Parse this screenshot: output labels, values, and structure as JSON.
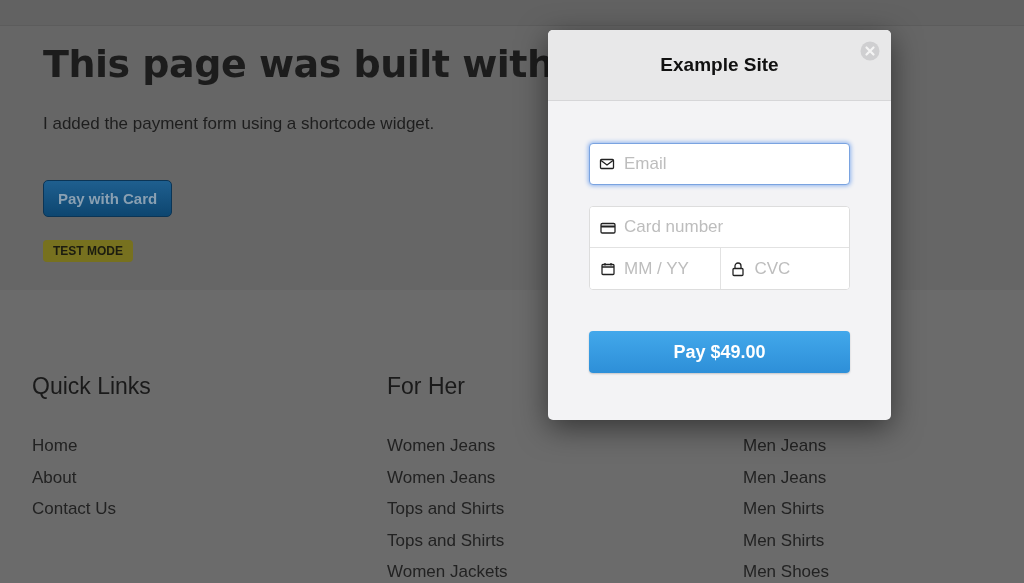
{
  "page": {
    "heading": "This page was built with",
    "text": "I added the payment form using a shortcode widget.",
    "pay_button": "Pay with Card",
    "badge": "TEST MODE"
  },
  "footer": {
    "columns": [
      {
        "heading": "Quick Links",
        "links": [
          "Home",
          "About",
          "Contact Us"
        ]
      },
      {
        "heading": "For Her",
        "links": [
          "Women Jeans",
          "Women Jeans",
          "Tops and Shirts",
          "Tops and Shirts",
          "Women Jackets"
        ]
      },
      {
        "links": [
          "Men Jeans",
          "Men Jeans",
          "Men Shirts",
          "Men Shirts",
          "Men Shoes"
        ]
      }
    ]
  },
  "modal": {
    "title": "Example Site",
    "fields": [
      {
        "kind": "email",
        "placeholder": "Email",
        "focused": true
      },
      {
        "kind": "card",
        "placeholder": "Card number",
        "focused": false
      },
      {
        "kind": "expiry",
        "placeholder": "MM / YY",
        "focused": false
      },
      {
        "kind": "cvc",
        "placeholder": "CVC",
        "focused": false
      }
    ],
    "submit": "Pay $49.00"
  }
}
